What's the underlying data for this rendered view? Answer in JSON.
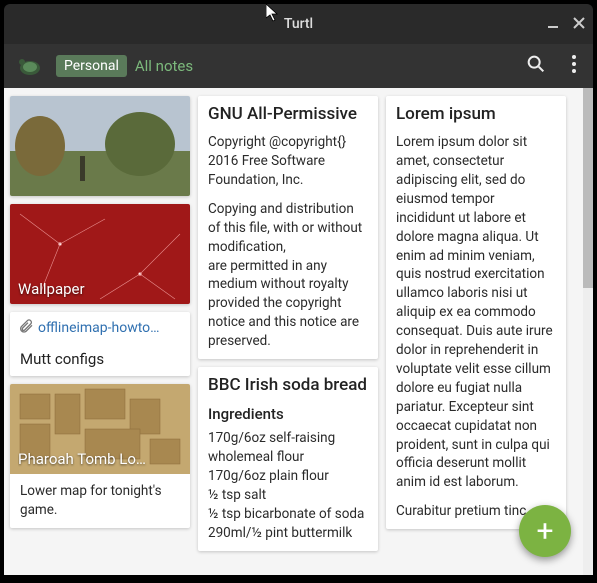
{
  "window": {
    "title": "Turtl"
  },
  "toolbar": {
    "tag": "Personal",
    "scope": "All notes"
  },
  "cards": {
    "wallpaper": {
      "title": "Wallpaper"
    },
    "offlineimap": {
      "attachment": "offlineimap-howto…",
      "title": "Mutt configs"
    },
    "pharoah": {
      "title": "Pharoah Tomb Lo…",
      "body": "Lower map for tonight's game."
    },
    "gnu": {
      "title": "GNU All-Permissive",
      "p1": "Copyright @copyright{} 2016 Free Software Foundation, Inc.",
      "p2": "Copying and distribution of this file, with or without modification,",
      "p3": "are permitted in any medium without royalty provided the copyright notice and this notice are preserved."
    },
    "bbc": {
      "title": "BBC Irish soda bread",
      "subtitle": "Ingredients",
      "l1": "170g/6oz self-raising wholemeal flour",
      "l2": "170g/6oz plain flour",
      "l3": "½ tsp salt",
      "l4": "½ tsp bicarbonate of soda",
      "l5": "290ml/½ pint buttermilk"
    },
    "lorem": {
      "title": "Lorem ipsum",
      "p1": "Lorem ipsum dolor sit amet, consectetur adipiscing elit, sed do eiusmod tempor incididunt ut labore et dolore magna aliqua. Ut enim ad minim veniam, quis nostrud exercitation ullamco laboris nisi ut aliquip ex ea commodo consequat. Duis aute irure dolor in reprehenderit in voluptate velit esse cillum dolore eu fugiat nulla pariatur. Excepteur sint occaecat cupidatat non proident, sunt in culpa qui officia deserunt mollit anim id est laborum.",
      "p2": "Curabitur pretium tinc"
    }
  }
}
